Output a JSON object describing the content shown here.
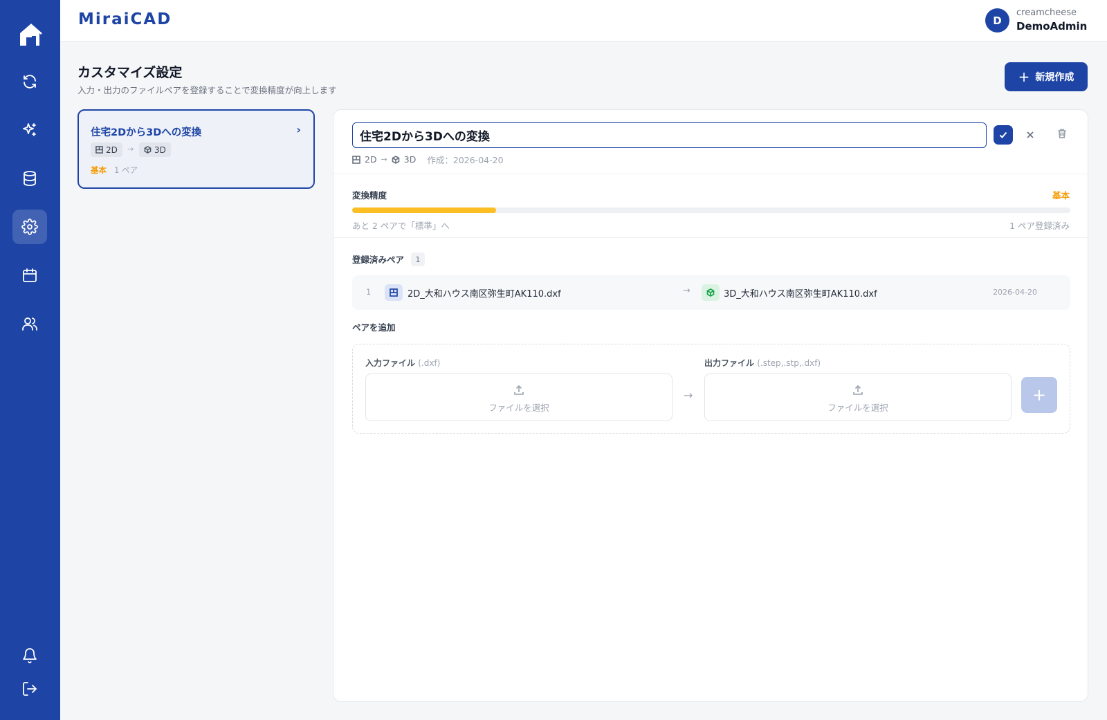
{
  "app": {
    "brand": "MiraiCAD"
  },
  "user": {
    "avatar_initial": "D",
    "org": "creamcheese",
    "name": "DemoAdmin"
  },
  "sidebar": {
    "items": [
      {
        "icon": "home-logo-icon"
      },
      {
        "icon": "refresh-icon"
      },
      {
        "icon": "sparkles-icon"
      },
      {
        "icon": "database-icon"
      },
      {
        "icon": "gear-icon",
        "active": true
      },
      {
        "icon": "calendar-icon"
      },
      {
        "icon": "users-icon"
      },
      {
        "icon": "bell-icon"
      },
      {
        "icon": "logout-icon"
      }
    ]
  },
  "page": {
    "title": "カスタマイズ設定",
    "subtitle": "入力・出力のファイルペアを登録することで変換精度が向上します",
    "new_button_plus": "+",
    "new_button": "新規作成"
  },
  "list": {
    "items": [
      {
        "title": "住宅2Dから3Dへの変換",
        "chevron": "›",
        "input_type": "2D",
        "arrow": "→",
        "output_type": "3D",
        "level": "基本",
        "pairs": "1 ペア"
      }
    ]
  },
  "detail": {
    "name_value": "住宅2Dから3Dへの変換",
    "input_type": "2D",
    "arrow": "→",
    "output_type": "3D",
    "created": "作成：2026-04-20",
    "accuracy": {
      "label": "変換精度",
      "level": "基本",
      "progress_percent": 20,
      "hint": "あと 2 ペアで「標準」へ",
      "count": "1 ペア登録済み",
      "color": "#fbbf24"
    },
    "registered": {
      "label": "登録済みペア",
      "count": "1",
      "rows": [
        {
          "index": "1",
          "input_file": "2D_大和ハウス南区弥生町AK110.dxf",
          "arrow": "→",
          "output_file": "3D_大和ハウス南区弥生町AK110.dxf",
          "date": "2026-04-20"
        }
      ]
    },
    "add": {
      "label": "ペアを追加",
      "input_label": "入力ファイル",
      "input_ext": "(.dxf)",
      "input_drop": "ファイルを選択",
      "arrow": "→",
      "output_label": "出力ファイル",
      "output_ext": "(.step,.stp,.dxf)",
      "output_drop": "ファイルを選択",
      "add_button": "+"
    }
  },
  "colors": {
    "primary": "#1e45a6",
    "warning": "#f59e0b",
    "success": "#16a34a"
  }
}
